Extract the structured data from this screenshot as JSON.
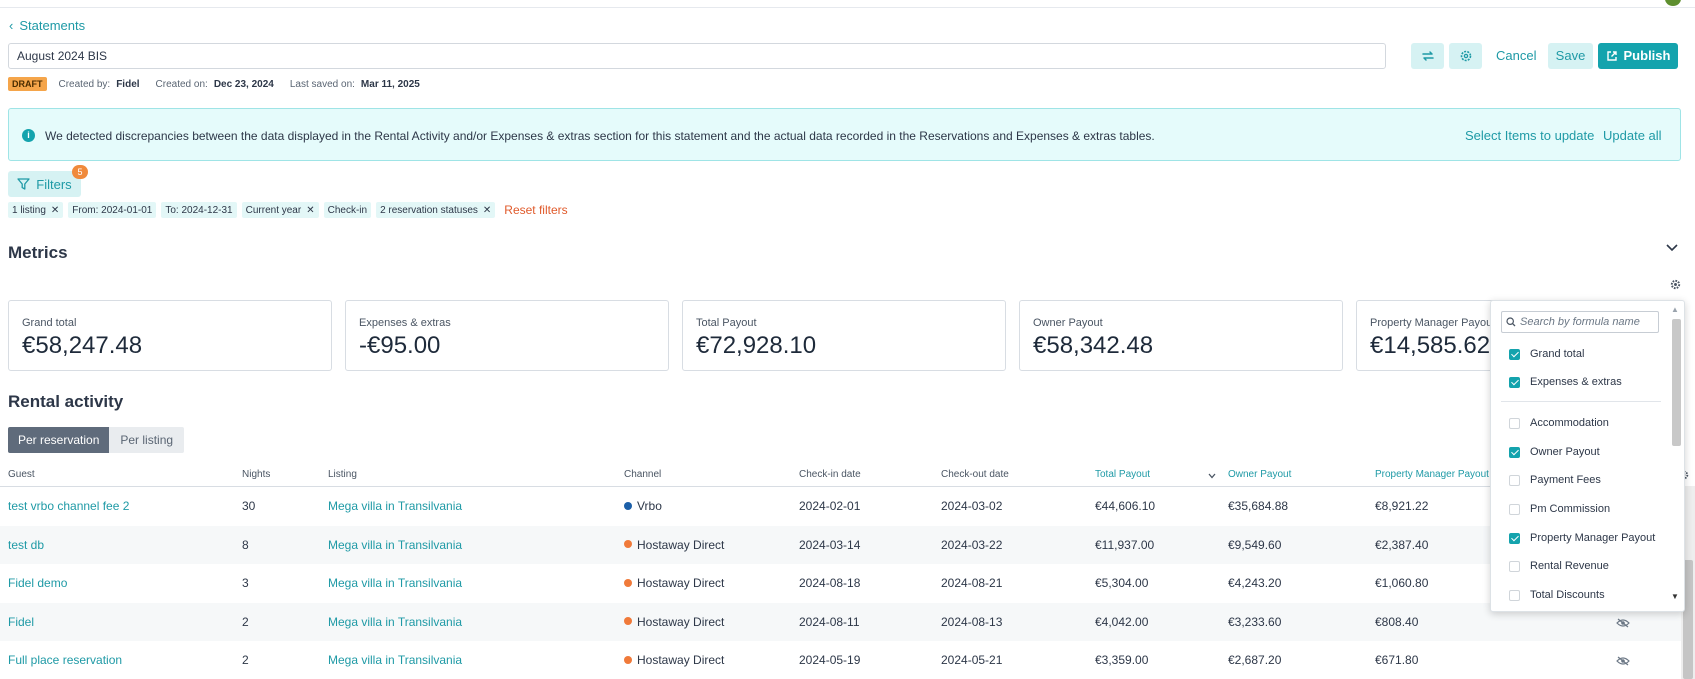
{
  "header": {
    "back_label": "Statements",
    "statement_title": "August 2024 BIS",
    "cancel_label": "Cancel",
    "save_label": "Save",
    "publish_label": "Publish",
    "status_badge": "DRAFT",
    "created_by_label": "Created by:",
    "created_by": "Fidel",
    "created_on_label": "Created on:",
    "created_on": "Dec 23, 2024",
    "last_saved_label": "Last saved on:",
    "last_saved": "Mar 11, 2025"
  },
  "alert": {
    "message": "We detected discrepancies between the data displayed in the Rental Activity and/or Expenses & extras section for this statement and the actual data recorded in the Reservations and Expenses & extras tables.",
    "select_items_label": "Select Items to update",
    "update_all_label": "Update all"
  },
  "filters": {
    "label": "Filters",
    "count": "5",
    "chips": [
      {
        "label": "1 listing",
        "removable": true
      },
      {
        "label": "From: 2024-01-01",
        "removable": false
      },
      {
        "label": "To: 2024-12-31",
        "removable": false
      },
      {
        "label": "Current year",
        "removable": true
      },
      {
        "label": "Check-in",
        "removable": false
      },
      {
        "label": "2 reservation statuses",
        "removable": true
      }
    ],
    "reset_label": "Reset filters"
  },
  "metrics": {
    "title": "Metrics",
    "cards": [
      {
        "label": "Grand total",
        "value": "€58,247.48"
      },
      {
        "label": "Expenses & extras",
        "value": "-€95.00"
      },
      {
        "label": "Total Payout",
        "value": "€72,928.10"
      },
      {
        "label": "Owner Payout",
        "value": "€58,342.48"
      },
      {
        "label": "Property Manager Payout",
        "value": "€14,585.62"
      }
    ]
  },
  "rental_activity": {
    "title": "Rental activity",
    "tabs": [
      "Per reservation",
      "Per listing"
    ],
    "columns": [
      "Guest",
      "Nights",
      "Listing",
      "Channel",
      "Check-in date",
      "Check-out date",
      "Total Payout",
      "Owner Payout",
      "Property Manager Payout"
    ],
    "rows": [
      {
        "guest": "test vrbo channel fee 2",
        "nights": "30",
        "listing": "Mega villa in Transilvania",
        "channel": "Vrbo",
        "channel_color": "#1c5fa8",
        "checkin": "2024-02-01",
        "checkout": "2024-03-02",
        "total": "€44,606.10",
        "owner": "€35,684.88",
        "pm": "€8,921.22"
      },
      {
        "guest": "test db",
        "nights": "8",
        "listing": "Mega villa in Transilvania",
        "channel": "Hostaway Direct",
        "channel_color": "#f07a3a",
        "checkin": "2024-03-14",
        "checkout": "2024-03-22",
        "total": "€11,937.00",
        "owner": "€9,549.60",
        "pm": "€2,387.40"
      },
      {
        "guest": "Fidel demo",
        "nights": "3",
        "listing": "Mega villa in Transilvania",
        "channel": "Hostaway Direct",
        "channel_color": "#f07a3a",
        "checkin": "2024-08-18",
        "checkout": "2024-08-21",
        "total": "€5,304.00",
        "owner": "€4,243.20",
        "pm": "€1,060.80"
      },
      {
        "guest": "Fidel",
        "nights": "2",
        "listing": "Mega villa in Transilvania",
        "channel": "Hostaway Direct",
        "channel_color": "#f07a3a",
        "checkin": "2024-08-11",
        "checkout": "2024-08-13",
        "total": "€4,042.00",
        "owner": "€3,233.60",
        "pm": "€808.40"
      },
      {
        "guest": "Full place reservation",
        "nights": "2",
        "listing": "Mega villa in Transilvania",
        "channel": "Hostaway Direct",
        "channel_color": "#f07a3a",
        "checkin": "2024-05-19",
        "checkout": "2024-05-21",
        "total": "€3,359.00",
        "owner": "€2,687.20",
        "pm": "€671.80"
      }
    ]
  },
  "formula_dropdown": {
    "search_placeholder": "Search by formula name",
    "items": [
      {
        "label": "Grand total",
        "checked": true
      },
      {
        "label": "Expenses & extras",
        "checked": true
      },
      {
        "label": "Accommodation",
        "checked": false
      },
      {
        "label": "Owner Payout",
        "checked": true
      },
      {
        "label": "Payment Fees",
        "checked": false
      },
      {
        "label": "Pm Commission",
        "checked": false
      },
      {
        "label": "Property Manager Payout",
        "checked": true
      },
      {
        "label": "Rental Revenue",
        "checked": false
      },
      {
        "label": "Total Discounts",
        "checked": false
      }
    ]
  },
  "colors": {
    "accent": "#14a3ad",
    "accent_light": "#d6f2f3",
    "draft": "#f5a54a",
    "reset": "#e05a2b"
  }
}
